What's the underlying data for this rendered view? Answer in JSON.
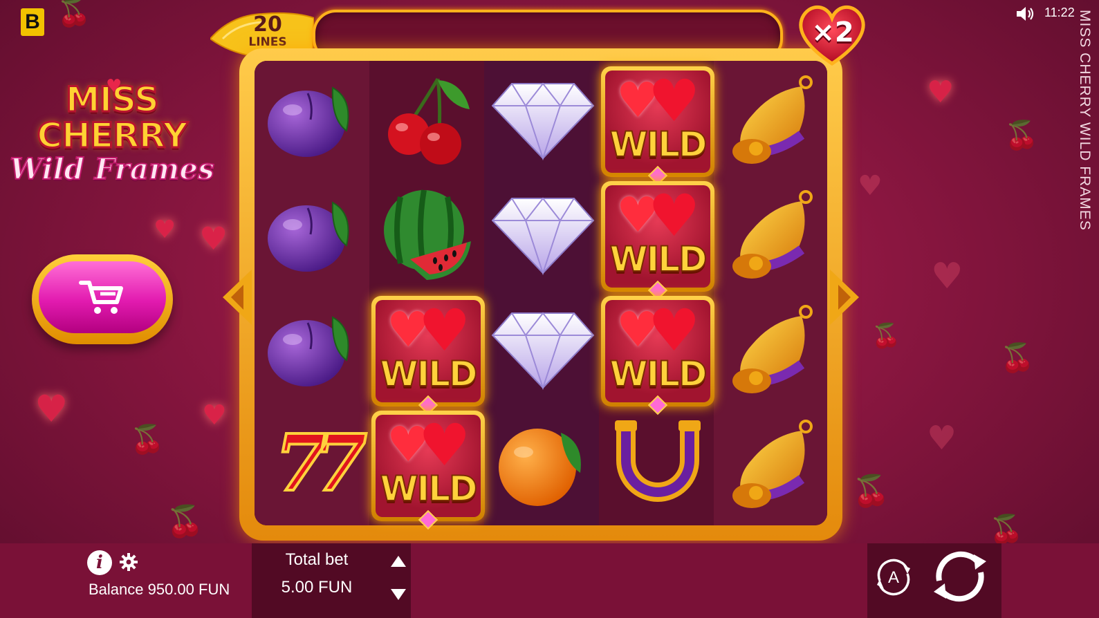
{
  "brand": {
    "letter": "B"
  },
  "status": {
    "time": "11:22"
  },
  "side_title": "MISS CHERRY WILD FRAMES",
  "logo": {
    "line1": "MISS",
    "line2": "CHERRY",
    "line3": "Wild Frames"
  },
  "lines": {
    "count": "20",
    "label": "LINES"
  },
  "multiplier": "×2",
  "reels": [
    [
      "plum",
      "plum",
      "plum",
      "seven"
    ],
    [
      "cherry",
      "watermelon",
      "wild",
      "wild"
    ],
    [
      "diamond",
      "diamond",
      "diamond",
      "orange"
    ],
    [
      "wild",
      "wild",
      "wild",
      "horseshoe"
    ],
    [
      "bell",
      "bell",
      "bell",
      "bell"
    ]
  ],
  "wild_label": "WILD",
  "seven_label": "77",
  "footer": {
    "balance": "Balance 950.00 FUN",
    "total_bet_label": "Total bet",
    "total_bet_value": "5.00 FUN",
    "auto_label": "A"
  },
  "colors": {
    "accent_gold": "#ffb21c",
    "background": "#8a1640",
    "buy_pink": "#e21bb0"
  }
}
